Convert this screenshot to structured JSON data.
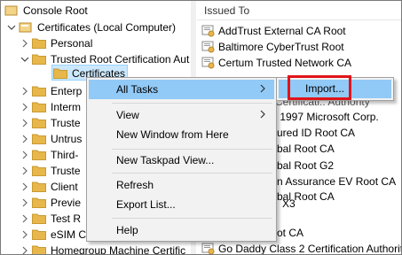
{
  "tree": {
    "console_root": "Console Root",
    "certificates_local": "Certificates (Local Computer)",
    "personal": "Personal",
    "trusted_root": "Trusted Root Certification Aut",
    "certificates": "Certificates",
    "enterprise": "Enterp",
    "intermediate": "Interm",
    "trusted_publishers": "Truste",
    "untrusted": "Untrus",
    "third_party": "Third-",
    "trusted_people": "Truste",
    "client": "Client",
    "preview": "Previe",
    "test_roots": "Test R",
    "esim": "eSIM C",
    "homegroup": "Homegroup Machine Certific"
  },
  "list": {
    "column_header": "Issued To",
    "rows": [
      "AddTrust External CA Root",
      "Baltimore CyberTrust Root",
      "Certum Trusted Network CA",
      "Certificati.. Authority",
      ") 1997 Microsoft Corp.",
      "ured ID Root CA",
      "bal Root CA",
      "bal Root G2",
      "n Assurance EV Root CA",
      "bal Root CA",
      "X3",
      "",
      "ot CA",
      "Go Daddy Class 2 Certification Authority"
    ]
  },
  "menu": {
    "all_tasks": "All Tasks",
    "view": "View",
    "new_window": "New Window from Here",
    "new_taskpad": "New Taskpad View...",
    "refresh": "Refresh",
    "export_list": "Export List...",
    "help": "Help"
  },
  "submenu": {
    "import": "Import..."
  },
  "colors": {
    "highlight": "#91c9f7",
    "selection": "#cce8ff",
    "outline": "#e0141a",
    "folder": "#e8b74c"
  }
}
